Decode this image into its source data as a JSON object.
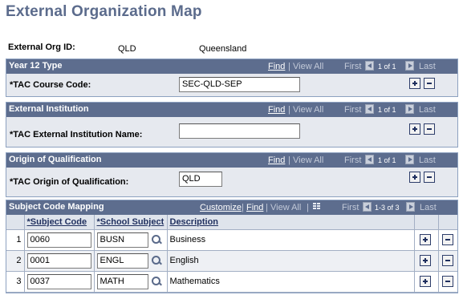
{
  "page_title": "External Organization Map",
  "ext_org": {
    "label": "External Org ID:",
    "code": "QLD",
    "description": "Queensland"
  },
  "nav": {
    "find": "Find",
    "sep": "|",
    "view_all": "View All",
    "first": "First",
    "last": "Last",
    "customize": "Customize",
    "one_of_one": "1 of 1",
    "one_three_of_three": "1-3 of 3"
  },
  "sections": {
    "year12": {
      "title": "Year 12 Type",
      "field_label": "*TAC Course Code:",
      "value": "SEC-QLD-SEP"
    },
    "institution": {
      "title": "External Institution",
      "field_label": "*TAC External Institution Name:",
      "value": ""
    },
    "origin": {
      "title": "Origin of Qualification",
      "field_label": "*TAC Origin of Qualification:",
      "value": "QLD"
    }
  },
  "subject_grid": {
    "title": "Subject Code Mapping",
    "columns": [
      "*Subject Code",
      "*School Subject",
      "Description"
    ],
    "rows": [
      {
        "num": "1",
        "subject_code": "0060",
        "school_subject": "BUSN",
        "description": "Business"
      },
      {
        "num": "2",
        "subject_code": "0001",
        "school_subject": "ENGL",
        "description": "English"
      },
      {
        "num": "3",
        "subject_code": "0037",
        "school_subject": "MATH",
        "description": "Mathematics"
      }
    ]
  },
  "colors": {
    "header_bg": "#5d6d8e",
    "title": "#5b6b8c",
    "body_bg": "#e6e9ef"
  },
  "icons": [
    "add-row-icon",
    "delete-row-icon",
    "lookup-icon",
    "grid-download-icon",
    "first-arrow-icon",
    "last-arrow-icon"
  ]
}
